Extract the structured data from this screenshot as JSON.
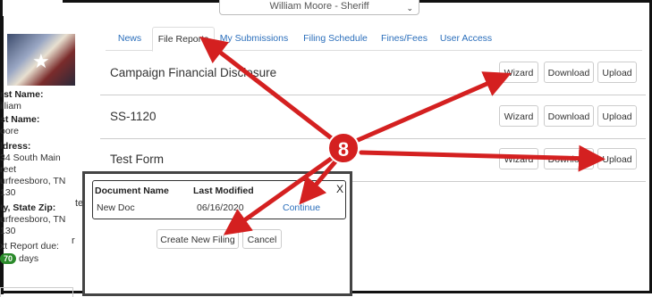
{
  "header": {
    "user_select": "William Moore - Sheriff"
  },
  "sidebar": {
    "first_name_label": "rst Name:",
    "first_name_value": "illiam",
    "last_name_label": "st Name:",
    "last_name_value": "oore",
    "address_label": "ldress:",
    "address_line1": "34 South Main",
    "address_line2": "reet",
    "address_line3": "urfreesboro, TN",
    "address_line4": "130",
    "city_label": "ty, State Zip:",
    "city_line1": "urfreesboro, TN",
    "city_line2": "130",
    "next_due_label": "xt Report due:",
    "days_badge": "70",
    "days_label": "days"
  },
  "tabs": [
    "News",
    "File Reports",
    "My Submissions",
    "Filing Schedule",
    "Fines/Fees",
    "User Access"
  ],
  "reports": [
    {
      "title": "Campaign Financial Disclosure",
      "wizard": "Wizard",
      "download": "Download",
      "upload": "Upload"
    },
    {
      "title": "SS-1120",
      "wizard": "Wizard",
      "download": "Download",
      "upload": "Upload"
    },
    {
      "title": "Test Form",
      "wizard": "Wizard",
      "download": "Download",
      "upload": "Upload"
    }
  ],
  "modal": {
    "col_name": "Document Name",
    "col_modified": "Last Modified",
    "row_name": "New Doc",
    "row_modified": "06/16/2020",
    "row_action": "Continue",
    "close": "X",
    "create_button": "Create New Filing",
    "cancel_button": "Cancel"
  },
  "annotation": {
    "step_number": "8",
    "color": "#d42020"
  },
  "partial_text": {
    "behind_modal_1": "te",
    "behind_modal_2": "r"
  }
}
